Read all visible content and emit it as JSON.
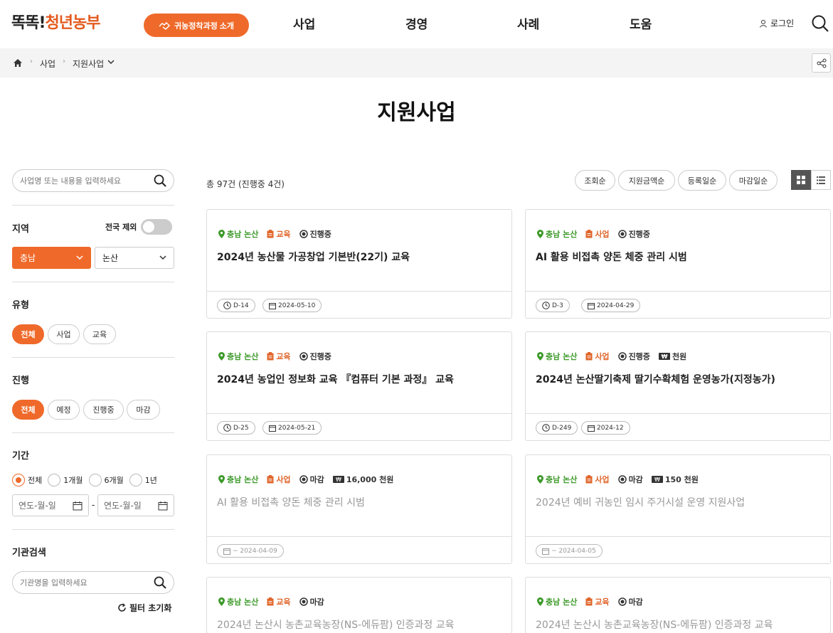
{
  "header": {
    "logo_part1": "똑똑!",
    "logo_part2": "청년농부",
    "policy_button": "귀농정착과정 소개",
    "nav": [
      "사업",
      "경영",
      "사례",
      "도움"
    ],
    "login": "로그인"
  },
  "breadcrumb": {
    "items": [
      "사업",
      "지원사업"
    ]
  },
  "page_title": "지원사업",
  "sidebar": {
    "search_placeholder": "사업명 또는 내용을 입력하세요",
    "region": {
      "title": "지역",
      "toggle_label": "전국 제외",
      "province": "충남",
      "city": "논산"
    },
    "type": {
      "title": "유형",
      "options": [
        "전체",
        "사업",
        "교육"
      ],
      "selected": "전체"
    },
    "progress": {
      "title": "진행",
      "options": [
        "전체",
        "예정",
        "진행중",
        "마감"
      ],
      "selected": "전체"
    },
    "period": {
      "title": "기간",
      "options": [
        "전체",
        "1개월",
        "6개월",
        "1년"
      ],
      "selected": "전체",
      "date_placeholder": "연도-월-일",
      "date_separator": "-"
    },
    "agency": {
      "title": "기관검색",
      "placeholder": "기관명을 입력하세요"
    },
    "reset_label": "필터 초기화"
  },
  "list": {
    "total": "총 97건 (진행중 4건)",
    "sort_options": [
      "조회순",
      "지원금액순",
      "등록일순",
      "마감일순"
    ],
    "view_mode": "grid"
  },
  "cards": [
    {
      "region": "충남 논산",
      "type": "교육",
      "status": "진행중",
      "amount": "",
      "title": "2024년 농산물 가공창업 기본반(22기) 교육",
      "dday": "D-14",
      "date": "2024-05-10",
      "closed": false
    },
    {
      "region": "충남 논산",
      "type": "사업",
      "status": "진행중",
      "amount": "",
      "title": "AI 활용 비접촉 양돈 체중 관리 시범",
      "dday": "D-3",
      "date": "2024-04-29",
      "closed": false
    },
    {
      "region": "충남 논산",
      "type": "교육",
      "status": "진행중",
      "amount": "",
      "title": "2024년 농업인 정보화 교육 『컴퓨터 기본 과정』 교육",
      "dday": "D-25",
      "date": "2024-05-21",
      "closed": false
    },
    {
      "region": "충남 논산",
      "type": "사업",
      "status": "진행중",
      "amount": "천원",
      "title": "2024년 논산딸기축제 딸기수확체험 운영농가(지정농가)",
      "dday": "D-249",
      "date": "2024-12",
      "closed": false
    },
    {
      "region": "충남 논산",
      "type": "사업",
      "status": "마감",
      "amount": "16,000 천원",
      "title": "AI 활용 비접촉 양돈 체중 관리 시범",
      "dday": "",
      "date": "~ 2024-04-09",
      "closed": true
    },
    {
      "region": "충남 논산",
      "type": "사업",
      "status": "마감",
      "amount": "150 천원",
      "title": "2024년 예비 귀농인 임시 주거시설 운영 지원사업",
      "dday": "",
      "date": "~ 2024-04-05",
      "closed": true
    },
    {
      "region": "충남 논산",
      "type": "교육",
      "status": "마감",
      "amount": "",
      "title": "2024년 논산시 농촌교육농장(NS-에듀팜) 인증과정 교육",
      "dday": "",
      "date": "",
      "closed": true
    },
    {
      "region": "충남 논산",
      "type": "교육",
      "status": "마감",
      "amount": "",
      "title": "2024년 논산시 농촌교육농장(NS-에듀팜) 인증과정 교육",
      "dday": "",
      "date": "",
      "closed": true
    }
  ],
  "colors": {
    "accent": "#ef6a2a",
    "region_green": "#3d9a2a",
    "type_orange": "#e0652a",
    "closed_gray": "#999999"
  }
}
